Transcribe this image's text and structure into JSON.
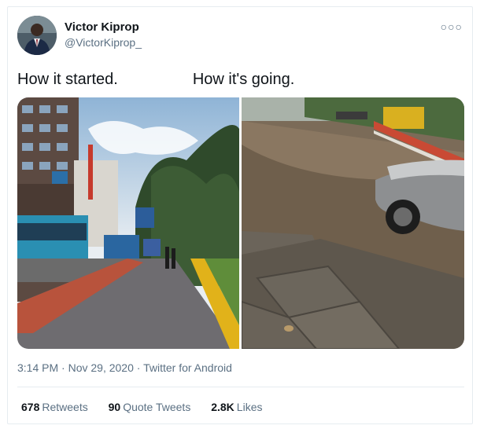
{
  "author": {
    "name": "Victor Kiprop",
    "handle": "@VictorKiprop_"
  },
  "more_icon": "more-options-icon",
  "tweet": {
    "text_left": "How it started.",
    "text_right": "How it's going."
  },
  "media": {
    "left_image": "city-street-sunny",
    "right_image": "flooded-street"
  },
  "meta": {
    "time": "3:14 PM",
    "sep1": "·",
    "date": "Nov 29, 2020",
    "sep2": "·",
    "source": "Twitter for Android"
  },
  "stats": {
    "retweets_count": "678",
    "retweets_label": "Retweets",
    "quotes_count": "90",
    "quotes_label": "Quote Tweets",
    "likes_count": "2.8K",
    "likes_label": "Likes"
  },
  "colors": {
    "text_primary": "#0f1419",
    "text_secondary": "#5b7083",
    "border": "#e6ecf0"
  }
}
